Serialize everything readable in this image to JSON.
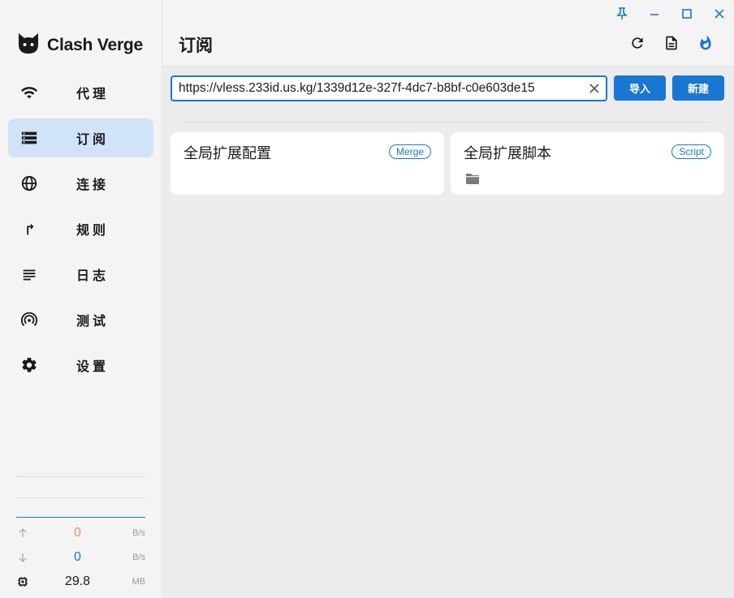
{
  "app": {
    "name": "Clash Verge"
  },
  "sidebar": {
    "items": [
      {
        "label": "代理",
        "icon": "wifi-icon"
      },
      {
        "label": "订阅",
        "icon": "storage-icon",
        "active": true
      },
      {
        "label": "连接",
        "icon": "globe-icon"
      },
      {
        "label": "规则",
        "icon": "fork-arrow-icon"
      },
      {
        "label": "日志",
        "icon": "lines-icon"
      },
      {
        "label": "测试",
        "icon": "radar-icon"
      },
      {
        "label": "设置",
        "icon": "gear-icon"
      }
    ]
  },
  "traffic": {
    "upload": {
      "value": "0",
      "unit": "B/s",
      "color": "#ef8a6b"
    },
    "download": {
      "value": "0",
      "unit": "B/s",
      "color": "#1976d2"
    },
    "memory": {
      "value": "29.8",
      "unit": "MB"
    }
  },
  "header": {
    "title": "订阅",
    "actions": [
      "refresh-icon",
      "document-icon",
      "fire-icon"
    ]
  },
  "import": {
    "url_value": "https://vless.233id.us.kg/1339d12e-327f-4dc7-b8bf-c0e603de15",
    "import_label": "导入",
    "new_label": "新建"
  },
  "cards": [
    {
      "title": "全局扩展配置",
      "badge": "Merge"
    },
    {
      "title": "全局扩展脚本",
      "badge": "Script",
      "icon": "folder-icon"
    }
  ],
  "colors": {
    "accent": "#1976d2",
    "active_bg": "#d1e3f8"
  }
}
